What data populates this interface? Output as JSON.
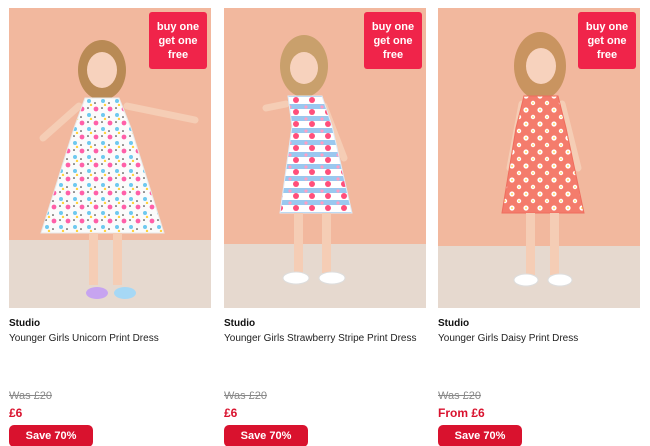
{
  "promo_badge": {
    "line1": "buy one",
    "line2": "get one",
    "line3": "free"
  },
  "products": [
    {
      "brand": "Studio",
      "title": "Younger Girls Unicorn Print Dress",
      "was_price": "Was £20",
      "price": "£6",
      "save_label": "Save 70%",
      "image_subject": "girl in white unicorn print dress"
    },
    {
      "brand": "Studio",
      "title": "Younger Girls Strawberry Stripe Print Dress",
      "was_price": "Was £20",
      "price": "£6",
      "save_label": "Save 70%",
      "image_subject": "girl in striped strawberry print dress"
    },
    {
      "brand": "Studio",
      "title": "Younger Girls Daisy Print Dress",
      "was_price": "Was £20",
      "price": "From £6",
      "save_label": "Save 70%",
      "image_subject": "girl in coral daisy print dress"
    }
  ],
  "colors": {
    "promo_red": "#f0244a",
    "price_red": "#d9122e",
    "wall_peach": "#f2b89e",
    "floor_sand": "#e6d9cf"
  }
}
